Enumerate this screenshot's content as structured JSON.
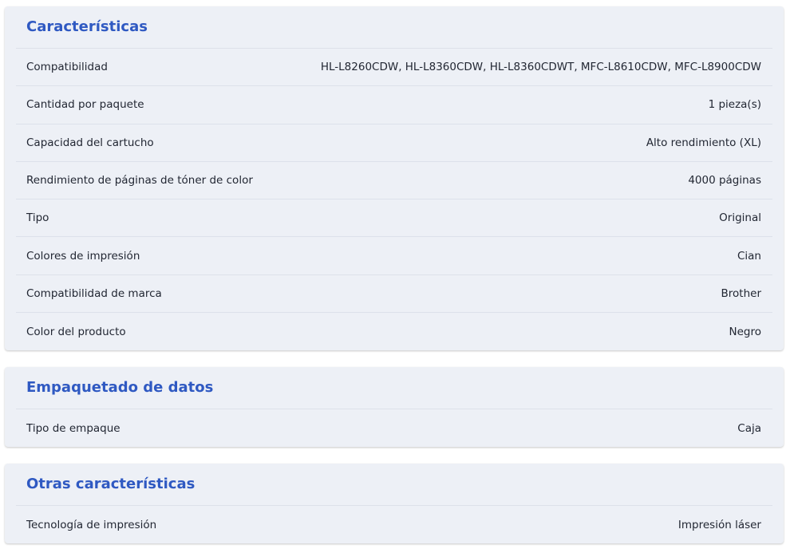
{
  "sections": [
    {
      "title": "Características",
      "rows": [
        {
          "label": "Compatibilidad",
          "value": "HL-L8260CDW, HL-L8360CDW, HL-L8360CDWT, MFC-L8610CDW, MFC-L8900CDW"
        },
        {
          "label": "Cantidad por paquete",
          "value": "1 pieza(s)"
        },
        {
          "label": "Capacidad del cartucho",
          "value": "Alto rendimiento (XL)"
        },
        {
          "label": "Rendimiento de páginas de tóner de color",
          "value": "4000 páginas"
        },
        {
          "label": "Tipo",
          "value": "Original"
        },
        {
          "label": "Colores de impresión",
          "value": "Cian"
        },
        {
          "label": "Compatibilidad de marca",
          "value": "Brother"
        },
        {
          "label": "Color del producto",
          "value": "Negro"
        }
      ]
    },
    {
      "title": "Empaquetado de datos",
      "rows": [
        {
          "label": "Tipo de empaque",
          "value": "Caja"
        }
      ]
    },
    {
      "title": "Otras características",
      "rows": [
        {
          "label": "Tecnología de impresión",
          "value": "Impresión láser"
        }
      ]
    }
  ],
  "colors": {
    "accent": "#2f59c2",
    "card_background": "#edf0f6",
    "divider": "#dde1ea",
    "text": "#222733"
  }
}
